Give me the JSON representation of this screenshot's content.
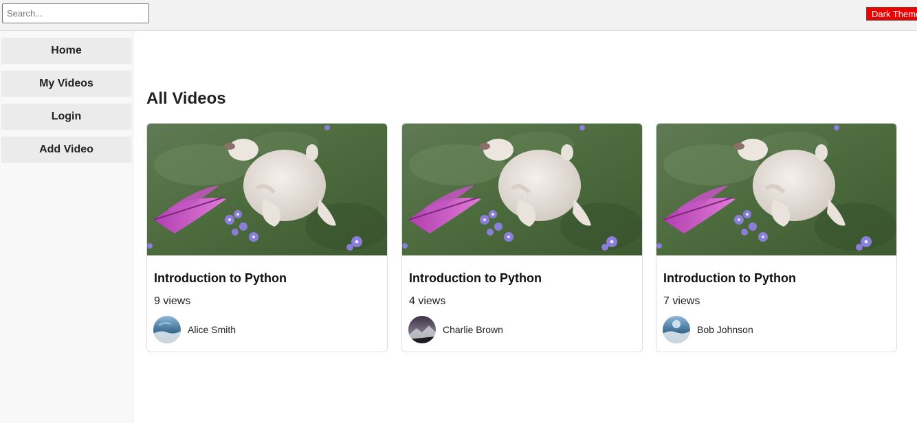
{
  "header": {
    "search_placeholder": "Search...",
    "search_value": "",
    "theme_button_label": "Dark Theme",
    "theme_button_color": "#ee0000"
  },
  "sidebar": {
    "items": [
      {
        "label": "Home"
      },
      {
        "label": "My Videos"
      },
      {
        "label": "Login"
      },
      {
        "label": "Add Video"
      }
    ]
  },
  "main": {
    "heading": "All Videos",
    "videos": [
      {
        "title": "Introduction to Python",
        "views": "9 views",
        "author": "Alice Smith",
        "avatar": "landscape-avatar-blue"
      },
      {
        "title": "Introduction to Python",
        "views": "4 views",
        "author": "Charlie Brown",
        "avatar": "landscape-avatar-dusk"
      },
      {
        "title": "Introduction to Python",
        "views": "7 views",
        "author": "Bob Johnson",
        "avatar": "landscape-avatar-blue"
      }
    ]
  }
}
